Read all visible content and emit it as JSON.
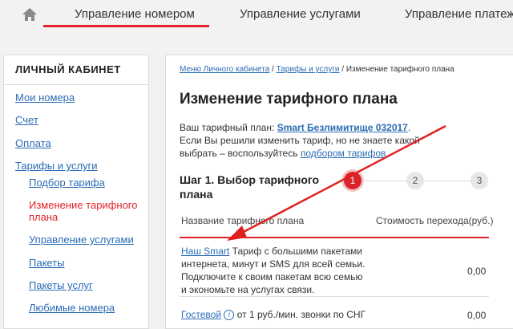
{
  "topnav": {
    "tabs": [
      {
        "label": "Управление номером"
      },
      {
        "label": "Управление услугами"
      },
      {
        "label": "Управление платежами"
      }
    ]
  },
  "sidebar": {
    "title": "ЛИЧНЫЙ КАБИНЕТ",
    "items": [
      {
        "label": "Мои номера"
      },
      {
        "label": "Счет"
      },
      {
        "label": "Оплата"
      },
      {
        "label": "Тарифы и услуги"
      },
      {
        "label": "Подбор тарифа"
      },
      {
        "label": "Изменение тарифного плана"
      },
      {
        "label": "Управление услугами"
      },
      {
        "label": "Пакеты"
      },
      {
        "label": "Пакеты услуг"
      },
      {
        "label": "Любимые номера"
      }
    ]
  },
  "breadcrumb": {
    "items": [
      "Меню Личного кабинета",
      "Тарифы и услуги",
      "Изменение тарифного плана"
    ],
    "separator": "/"
  },
  "main": {
    "title": "Изменение тарифного плана",
    "plan_prefix": "Ваш тарифный план:",
    "plan_name": "Smart Безлимитище 032017",
    "plan_suffix": ".",
    "hint_text": "Если Вы решили изменить тариф, но не знаете какой выбрать – воспользуйтесь",
    "hint_link": "подбором тарифов",
    "hint_end": "."
  },
  "steps": {
    "title": "Шаг 1. Выбор тарифного плана",
    "numbers": [
      "1",
      "2",
      "3"
    ],
    "accent_color": "#d9232a"
  },
  "table": {
    "headers": [
      "Название тарифного плана",
      "Стоимость перехода(руб.)"
    ],
    "rows": [
      {
        "name": "Наш Smart",
        "description": "Тариф с большими пакетами интернета, минут и SMS для всей семьи. Подключите к своим пакетам всю семью и экономьте на услугах связи.",
        "price": "0,00"
      },
      {
        "name": "Гостевой",
        "info_icon": "i",
        "description": "от 1 руб./мин. звонки по СНГ",
        "price": "0,00"
      }
    ]
  },
  "colors": {
    "brand_red": "#e3232a",
    "link_blue": "#2b6cb5"
  }
}
